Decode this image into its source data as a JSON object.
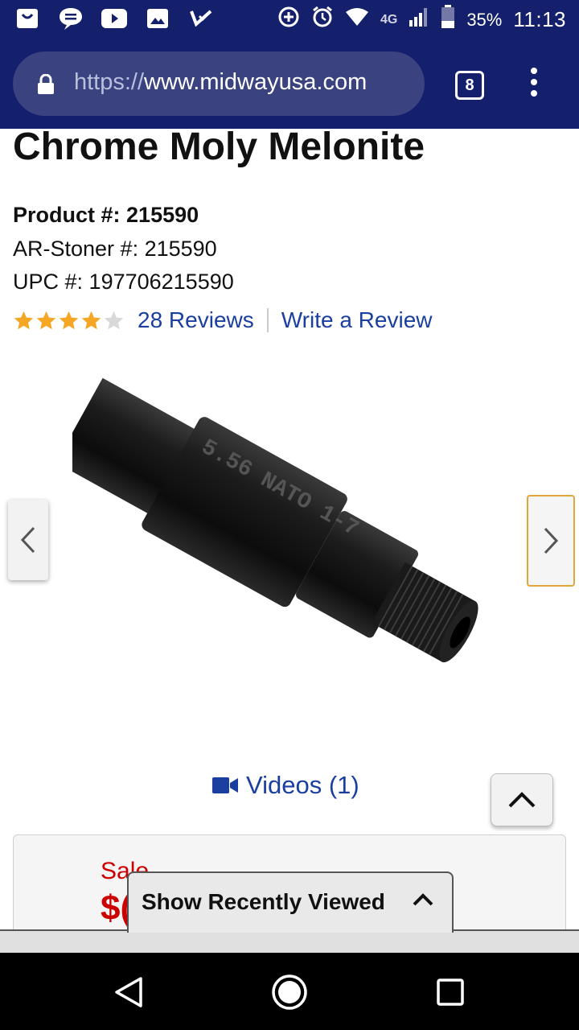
{
  "status_bar": {
    "network": "4G",
    "battery": "35%",
    "time": "11:13"
  },
  "browser": {
    "url_scheme": "https://",
    "url_host": "www.midwayusa.com",
    "tab_count": "8"
  },
  "product": {
    "title": "Chrome Moly Melonite",
    "product_label": "Product #:",
    "product_number": "215590",
    "stoner_label": "AR-Stoner #:",
    "stoner_number": "215590",
    "upc_label": "UPC #:",
    "upc_number": "197706215590",
    "rating_stars": 4,
    "rating_max": 5,
    "reviews_link": "28 Reviews",
    "write_review_link": "Write a Review",
    "image_caption": "5.56 NATO 1-7"
  },
  "media": {
    "videos_link": "Videos (1)"
  },
  "pricing": {
    "sale_label": "Sale",
    "sale_price_visible": "$("
  },
  "recently_viewed": {
    "label": "Show Recently Viewed"
  },
  "colors": {
    "header_blue": "#14206b",
    "link_blue": "#1a3fa0",
    "star_orange": "#f5a623",
    "sale_red": "#cc0000"
  }
}
